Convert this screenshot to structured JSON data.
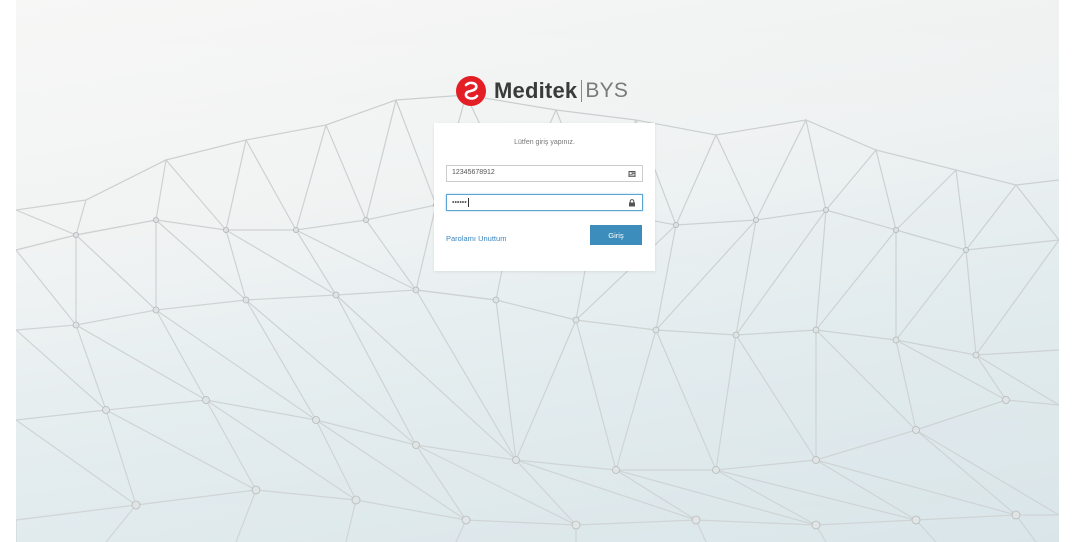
{
  "brand": {
    "name": "Meditek",
    "product": "BYS",
    "logo_color": "#e31e24"
  },
  "login": {
    "prompt": "Lütfen giriş yapınız.",
    "username_value": "12345678912",
    "username_icon": "id-card-icon",
    "password_value": "••••••",
    "password_icon": "lock-icon",
    "forgot_label": "Parolamı Unuttum",
    "submit_label": "Giriş",
    "accent_color": "#3c8dbc"
  }
}
